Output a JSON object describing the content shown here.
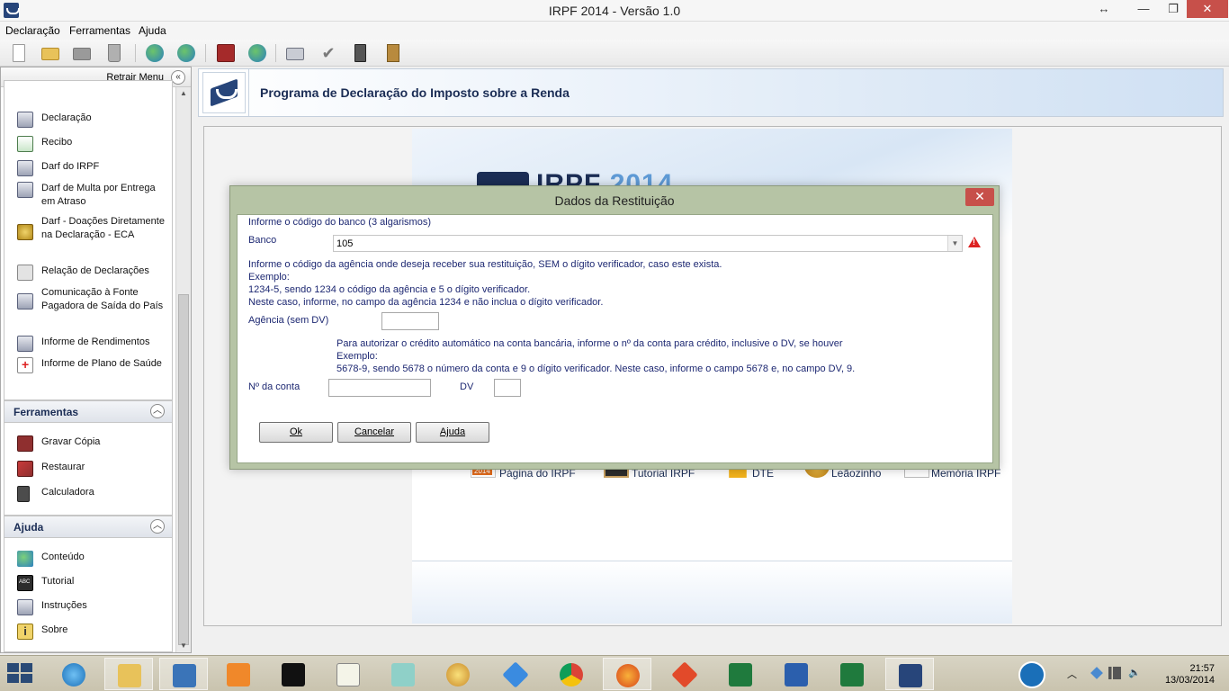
{
  "window": {
    "title": "IRPF 2014 - Versão 1.0",
    "controls": {
      "resize": "↔",
      "minimize": "—",
      "maximize": "❐",
      "close": "✕"
    }
  },
  "menubar": {
    "items": [
      {
        "label": "Declaração",
        "accel": "D"
      },
      {
        "label": "Ferramentas",
        "accel": "F"
      },
      {
        "label": "Ajuda",
        "accel": "A"
      }
    ]
  },
  "toolbar": {
    "icons": [
      "new-doc-icon",
      "open-folder-icon",
      "folder-icon",
      "trash-icon",
      "transmit-icon",
      "receive-icon",
      "save-icon",
      "globe-icon",
      "print-icon",
      "check-icon",
      "calculator-icon",
      "book-icon"
    ]
  },
  "sidebar": {
    "collapse_label": "Retrair Menu",
    "sections": {
      "imprimir": {
        "items": [
          {
            "label": "Declaração"
          },
          {
            "label": "Recibo"
          },
          {
            "label": "Darf do IRPF"
          },
          {
            "label": "Darf de Multa por Entrega em Atraso"
          },
          {
            "label": "Darf - Doações Diretamente na Declaração - ECA"
          },
          {
            "label": "Relação de Declarações"
          },
          {
            "label": "Comunicação à Fonte Pagadora de Saída do País"
          },
          {
            "label": "Informe de Rendimentos"
          },
          {
            "label": "Informe de Plano de Saúde"
          }
        ]
      },
      "ferramentas": {
        "title": "Ferramentas",
        "items": [
          {
            "label": "Gravar Cópia"
          },
          {
            "label": "Restaurar"
          },
          {
            "label": "Calculadora"
          }
        ]
      },
      "ajuda": {
        "title": "Ajuda",
        "items": [
          {
            "label": "Conteúdo"
          },
          {
            "label": "Tutorial"
          },
          {
            "label": "Instruções"
          },
          {
            "label": "Sobre"
          }
        ]
      }
    }
  },
  "banner": {
    "title": "Programa de Declaração do Imposto sobre a Renda"
  },
  "center": {
    "big_title": "IRPF",
    "big_year": "2014",
    "links": [
      {
        "label": "Página do IRPF"
      },
      {
        "label": "Tutorial IRPF"
      },
      {
        "label": "DTE"
      },
      {
        "label": "Leãozinho"
      },
      {
        "label": "Memória IRPF"
      }
    ]
  },
  "dialog": {
    "title": "Dados da Restituição",
    "close": "✕",
    "bank_hint": "Informe o código do banco (3 algarismos)",
    "bank_label": "Banco",
    "bank_value": "105",
    "agency_hint_1": "Informe o código da agência onde deseja receber sua restituição, SEM o dígito verificador, caso este exista.",
    "agency_hint_2": "Exemplo:",
    "agency_hint_3": "1234-5, sendo 1234 o código da agência e 5 o dígito verificador.",
    "agency_hint_4": "Neste caso, informe, no campo da agência 1234 e não inclua o dígito verificador.",
    "agency_label": "Agência (sem DV)",
    "agency_value": "",
    "account_hint_1": "Para autorizar o crédito automático na conta bancária, informe o nº da conta para crédito, inclusive o DV, se houver",
    "account_hint_2": "Exemplo:",
    "account_hint_3": "5678-9, sendo 5678 o número da conta e 9 o dígito verificador. Neste caso, informe o campo 5678 e, no campo DV, 9.",
    "account_label": "Nº da conta",
    "account_value": "",
    "dv_label": "DV",
    "dv_value": "",
    "buttons": {
      "ok": {
        "label": "Ok",
        "accel": "O"
      },
      "cancel": {
        "label": "Cancelar",
        "accel": "C"
      },
      "help": {
        "label": "Ajuda",
        "accel": "A"
      }
    }
  },
  "taskbar": {
    "apps": [
      "internet-explorer-icon",
      "file-explorer-icon",
      "virtualbox-icon",
      "media-player-icon",
      "command-prompt-icon",
      "notepad-icon",
      "notepad2-icon",
      "paint-icon",
      "dropbox-icon",
      "chrome-icon",
      "firefox-icon",
      "git-icon",
      "excel-csv-icon",
      "word-icon",
      "excel-icon",
      "irpf-icon"
    ],
    "clock_time": "21:57",
    "clock_date": "13/03/2014"
  }
}
